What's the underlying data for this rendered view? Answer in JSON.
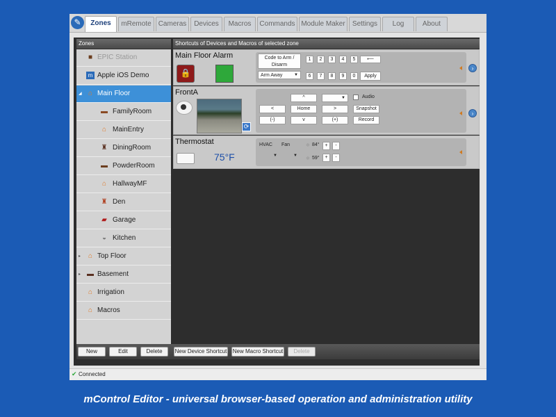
{
  "tabs": [
    {
      "label": "Zones",
      "active": true
    },
    {
      "label": "mRemote"
    },
    {
      "label": "Cameras"
    },
    {
      "label": "Devices"
    },
    {
      "label": "Macros"
    },
    {
      "label": "Commands"
    },
    {
      "label": "Module Maker"
    },
    {
      "label": "Settings"
    },
    {
      "label": "Log"
    },
    {
      "label": "About"
    }
  ],
  "zones_panel": {
    "title": "Zones",
    "items": [
      {
        "label": "EPIC Station",
        "icon": "house-icon"
      },
      {
        "label": "Apple iOS Demo",
        "icon": "app-icon"
      },
      {
        "label": "Main Floor",
        "icon": "house-icon",
        "selected": true
      },
      {
        "label": "FamilyRoom",
        "icon": "sofa-icon"
      },
      {
        "label": "MainEntry",
        "icon": "house-icon"
      },
      {
        "label": "DiningRoom",
        "icon": "chair-icon"
      },
      {
        "label": "PowderRoom",
        "icon": "sofa-icon"
      },
      {
        "label": "HallwayMF",
        "icon": "house-icon"
      },
      {
        "label": "Den",
        "icon": "chair-icon"
      },
      {
        "label": "Garage",
        "icon": "car-icon"
      },
      {
        "label": "Kitchen",
        "icon": "bowl-icon"
      },
      {
        "label": "Top Floor",
        "icon": "house-icon"
      },
      {
        "label": "Basement",
        "icon": "sofa-icon"
      },
      {
        "label": "Irrigation",
        "icon": "house-icon"
      },
      {
        "label": "Macros",
        "icon": "house-icon"
      }
    ],
    "buttons": {
      "new": "New",
      "edit": "Edit",
      "delete": "Delete"
    }
  },
  "shortcuts": {
    "title": "Shortcuts of Devices and Macros of selected zone",
    "alarm": {
      "name": "Main Floor Alarm",
      "code_prompt": "Code to Arm / Disarm",
      "mode": "Arm Away",
      "keys": [
        "1",
        "2",
        "3",
        "4",
        "5",
        "6",
        "7",
        "8",
        "9",
        "0"
      ],
      "backspace": "⟵",
      "apply": "Apply"
    },
    "camera": {
      "name": "FrontA",
      "up": "^",
      "down": "v",
      "left": "<",
      "right": ">",
      "home": "Home",
      "zoom_out": "(-)",
      "zoom_in": "(+)",
      "audio": "Audio",
      "snapshot": "Snapshot",
      "record": "Record"
    },
    "thermostat": {
      "name": "Thermostat",
      "temperature": "75°F",
      "hvac": "HVAC",
      "fan": "Fan",
      "heat_setpoint": "84°",
      "cool_setpoint": "59°",
      "plus": "+",
      "minus": "-"
    },
    "buttons": {
      "new_device": "New Device Shortcut",
      "new_macro": "New Macro Shortcut",
      "delete": "Delete"
    }
  },
  "status": "Connected",
  "caption": "mControl Editor - universal browser-based operation and administration utility"
}
